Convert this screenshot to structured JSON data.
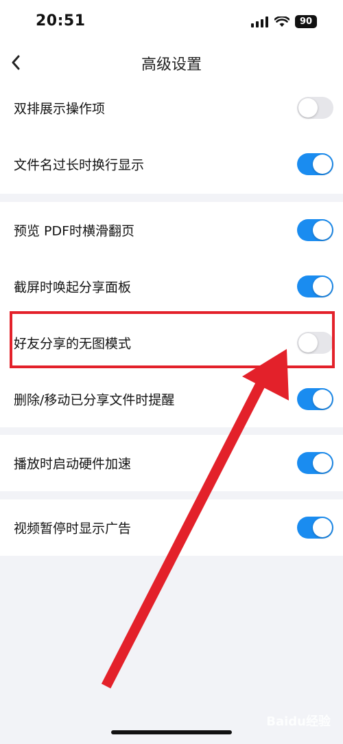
{
  "status_bar": {
    "time": "20:51",
    "battery": "90"
  },
  "nav": {
    "title": "高级设置"
  },
  "settings": {
    "double_row_actions": {
      "label": "双排展示操作项",
      "enabled": false
    },
    "wrap_long_filenames": {
      "label": "文件名过长时换行显示",
      "enabled": true
    },
    "pdf_horizontal_paging": {
      "label": "预览 PDF时横滑翻页",
      "enabled": true
    },
    "screenshot_share_panel": {
      "label": "截屏时唤起分享面板",
      "enabled": true
    },
    "friend_share_no_image": {
      "label": "好友分享的无图模式",
      "enabled": false
    },
    "delete_move_shared_reminder": {
      "label": "删除/移动已分享文件时提醒",
      "enabled": true
    },
    "hardware_acceleration": {
      "label": "播放时启动硬件加速",
      "enabled": true
    },
    "pause_show_ads": {
      "label": "视频暂停时显示广告",
      "enabled": true
    }
  },
  "colors": {
    "toggle_on": "#1a8cf0",
    "toggle_off": "#e6e6ea",
    "annotation": "#e3212a"
  },
  "watermark": "Baidu经验"
}
